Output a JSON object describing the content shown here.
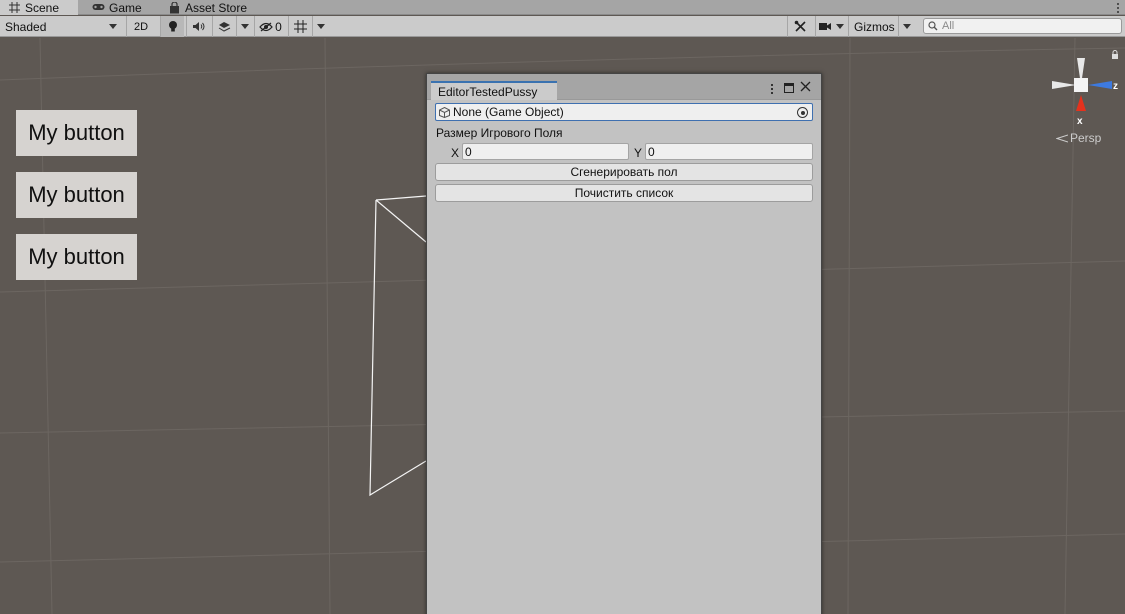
{
  "tabs": [
    {
      "label": "Scene",
      "icon": "grid-icon",
      "active": true
    },
    {
      "label": "Game",
      "icon": "gamepad-icon",
      "active": false
    },
    {
      "label": "Asset Store",
      "icon": "bag-icon",
      "active": false
    }
  ],
  "toolbar": {
    "draw_mode": "Shaded",
    "mode_2d": "2D",
    "hidden_count": "0",
    "gizmos": "Gizmos",
    "search_placeholder": "All"
  },
  "scene": {
    "buttons": [
      "My button",
      "My button",
      "My button"
    ],
    "gizmo_x": "x",
    "gizmo_z": "z",
    "projection": "Persp",
    "background_color": "#5e5853"
  },
  "editor_window": {
    "title": "EditorTestedPussy",
    "object_field": "None (Game Object)",
    "size_label": "Размер Игрового Поля",
    "x_label": "X",
    "x_value": "0",
    "y_label": "Y",
    "y_value": "0",
    "generate_button": "Сгенерировать пол",
    "clear_button": "Почистить список",
    "accent_color": "#3a72b0"
  }
}
